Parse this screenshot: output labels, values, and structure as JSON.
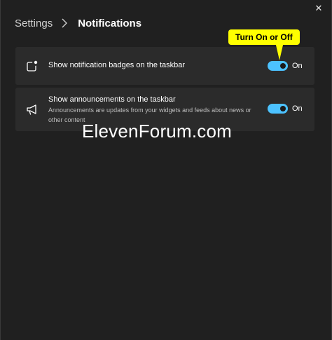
{
  "window": {
    "close_glyph": "✕",
    "close_icon": "close-icon"
  },
  "breadcrumb": {
    "parent": "Settings",
    "current": "Notifications",
    "separator_icon": "chevron-right-icon"
  },
  "settings": [
    {
      "icon": "notification-badge-icon",
      "title": "Show notification badges on the taskbar",
      "description": "",
      "toggle_on": true,
      "state_label": "On"
    },
    {
      "icon": "megaphone-icon",
      "title": "Show announcements on the taskbar",
      "description": "Announcements are updates from your widgets and feeds about news or other content",
      "toggle_on": true,
      "state_label": "On"
    }
  ],
  "callout": {
    "text": "Turn On or Off"
  },
  "watermark": {
    "text": "ElevenForum.com"
  },
  "colors": {
    "background": "#202020",
    "card": "#2b2b2b",
    "accent": "#4cc2ff",
    "callout": "#ffff00"
  }
}
